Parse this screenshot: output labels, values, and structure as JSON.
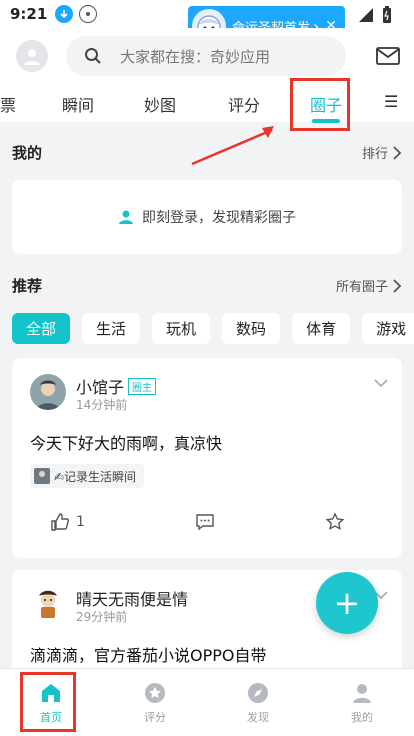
{
  "status_bar": {
    "time": "9:21"
  },
  "notification": {
    "text": "命运圣契首发",
    "arrow": "›",
    "close": "✕"
  },
  "header": {
    "search_placeholder": "大家都在搜：奇妙应用"
  },
  "tabs": [
    {
      "label": "票"
    },
    {
      "label": "瞬间"
    },
    {
      "label": "妙图"
    },
    {
      "label": "评分"
    },
    {
      "label": "圈子",
      "active": true
    },
    {
      "label": "☰"
    }
  ],
  "my_section": {
    "title": "我的",
    "link": "排行"
  },
  "login_card": {
    "text": "即刻登录，发现精彩圈子"
  },
  "recommend_section": {
    "title": "推荐",
    "link": "所有圈子"
  },
  "chips": [
    {
      "label": "全部",
      "active": true
    },
    {
      "label": "生活"
    },
    {
      "label": "玩机"
    },
    {
      "label": "数码"
    },
    {
      "label": "体育"
    },
    {
      "label": "游戏"
    }
  ],
  "posts": [
    {
      "author": "小馆子",
      "badge": "圈主",
      "time": "14分钟前",
      "text": "今天下好大的雨啊，真凉快",
      "tag": "✍记录生活瞬间",
      "likes": "1"
    },
    {
      "author": "晴天无雨便是情",
      "time": "29分钟前",
      "text": "滴滴滴，官方番茄小说OPPO自带"
    }
  ],
  "fab": {
    "label": "+"
  },
  "bottom_nav": [
    {
      "label": "首页",
      "icon": "home-icon",
      "active": true
    },
    {
      "label": "评分",
      "icon": "rating-icon"
    },
    {
      "label": "发现",
      "icon": "compass-icon"
    },
    {
      "label": "我的",
      "icon": "profile-icon"
    }
  ],
  "colors": {
    "accent": "#14c2c9",
    "annotation": "#e8352a"
  }
}
